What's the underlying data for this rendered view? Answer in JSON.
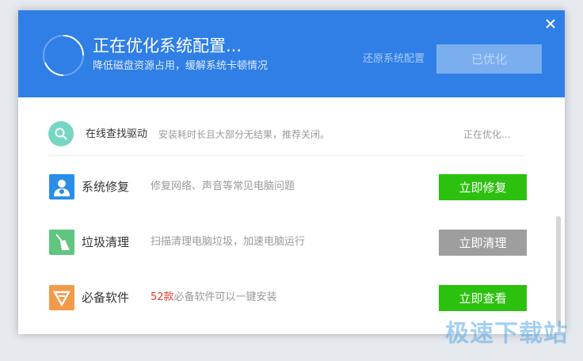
{
  "header": {
    "title": "正在优化系统配置...",
    "subtitle": "降低磁盘资源占用，缓解系统卡顿情况",
    "restore_link": "还原系统配置",
    "optimized_button": "已优化",
    "close_icon": "close-icon",
    "background_color": "#2f7fe6"
  },
  "top_item": {
    "icon": "search-icon",
    "name": "在线查找驱动",
    "description": "安装耗时长且大部分无结果，推荐关闭。",
    "status": "正在优化..."
  },
  "items": [
    {
      "icon": "system-repair-icon",
      "name": "系统修复",
      "description": "修复网络、声音等常见电脑问题",
      "button": "立即修复",
      "button_color": "#2dc10f",
      "icon_color": "#2a8ee8"
    },
    {
      "icon": "broom-icon",
      "name": "垃圾清理",
      "description": "扫描清理电脑垃圾，加速电脑运行",
      "button": "立即清理",
      "button_color": "#9e9e9e",
      "icon_color": "#5fc57f"
    },
    {
      "icon": "software-shield-icon",
      "name": "必备软件",
      "description_highlight": "52款",
      "description": "必备软件可以一键安装",
      "button": "立即查看",
      "button_color": "#2dc10f",
      "icon_color": "#f29a4a"
    }
  ],
  "watermark": "极速下载站"
}
